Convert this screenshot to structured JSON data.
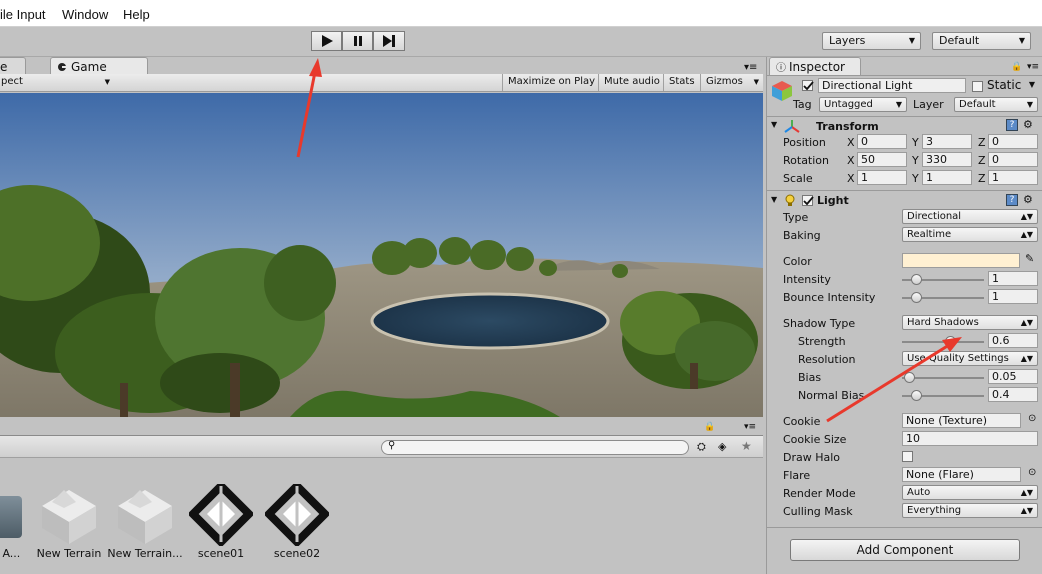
{
  "menubar": {
    "items": [
      "ile Input",
      "Window",
      "Help"
    ]
  },
  "toolbar": {
    "layers": "Layers",
    "layout": "Default"
  },
  "game": {
    "prev_tab_fragment": "e",
    "tab": "Game",
    "aspect": "pect",
    "maximize": "Maximize on Play",
    "mute": "Mute audio",
    "stats": "Stats",
    "gizmos": "Gizmos"
  },
  "project": {
    "assets": [
      {
        "label": "rd A...",
        "icon": "material-icon"
      },
      {
        "label": "New Terrain",
        "icon": "terrain-icon"
      },
      {
        "label": "New Terrain...",
        "icon": "terrain-icon"
      },
      {
        "label": "scene01",
        "icon": "unity-scene-icon"
      },
      {
        "label": "scene02",
        "icon": "unity-scene-icon"
      }
    ]
  },
  "inspector": {
    "tab": "Inspector",
    "object_name": "Directional Light",
    "static_label": "Static",
    "tag_label": "Tag",
    "tag_value": "Untagged",
    "layer_label": "Layer",
    "layer_value": "Default",
    "transform": {
      "title": "Transform",
      "position_label": "Position",
      "position": [
        "0",
        "3",
        "0"
      ],
      "rotation_label": "Rotation",
      "rotation": [
        "50",
        "330",
        "0"
      ],
      "scale_label": "Scale",
      "scale": [
        "1",
        "1",
        "1"
      ],
      "axes": [
        "X",
        "Y",
        "Z"
      ]
    },
    "light": {
      "title": "Light",
      "type_label": "Type",
      "type_value": "Directional",
      "baking_label": "Baking",
      "baking_value": "Realtime",
      "color_label": "Color",
      "color_value": "#fff0d2",
      "intensity_label": "Intensity",
      "intensity_value": "1",
      "intensity_level": 0.125,
      "bounce_label": "Bounce Intensity",
      "bounce_value": "1",
      "bounce_level": 0.125,
      "shadow_type_label": "Shadow Type",
      "shadow_type_value": "Hard Shadows",
      "strength_label": "Strength",
      "strength_value": "0.6",
      "strength_level": 0.6,
      "resolution_label": "Resolution",
      "resolution_value": "Use Quality Settings",
      "bias_label": "Bias",
      "bias_value": "0.05",
      "bias_level": 0.025,
      "normal_bias_label": "Normal Bias",
      "normal_bias_value": "0.4",
      "normal_bias_level": 0.13,
      "cookie_label": "Cookie",
      "cookie_value": "None (Texture)",
      "cookie_size_label": "Cookie Size",
      "cookie_size_value": "10",
      "draw_halo_label": "Draw Halo",
      "flare_label": "Flare",
      "flare_value": "None (Flare)",
      "render_mode_label": "Render Mode",
      "render_mode_value": "Auto",
      "culling_label": "Culling Mask",
      "culling_value": "Everything"
    },
    "add_component": "Add Component"
  },
  "annotation_color": "#e8392c"
}
